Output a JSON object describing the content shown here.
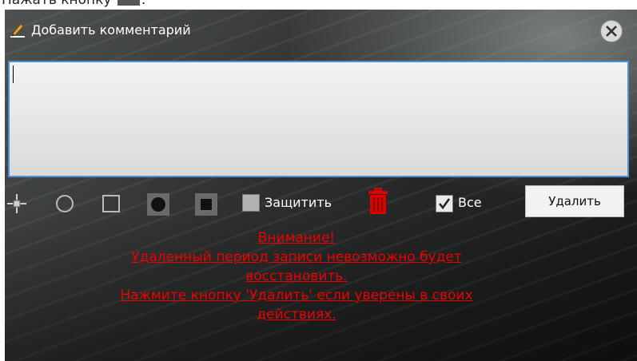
{
  "instruction": {
    "text_before": "Нажать кнопку",
    "text_after": "."
  },
  "dialog": {
    "title": "Добавить комментарий",
    "comment": {
      "value": "",
      "placeholder": ""
    },
    "toolbar": {
      "tools": [
        "crosshair-icon",
        "circle-outline-icon",
        "square-outline-icon",
        "circle-filled-icon",
        "square-filled-icon"
      ],
      "protect_label": "Защитить",
      "protect_checked": false,
      "trash_icon": "trash-icon",
      "all_label": "Все",
      "all_checked": true,
      "delete_label": "Удалить"
    },
    "warning": {
      "lines": [
        "Внимание!",
        "Удаленный период записи невозможно будет",
        "восстановить.",
        "Нажмите кнопку 'Удалить' если уверены в своих",
        "действиях."
      ],
      "color": "#ee0000"
    }
  },
  "colors": {
    "accent": "#4a90d9",
    "warning": "#ee0000",
    "pencil": "#e8a33a"
  }
}
